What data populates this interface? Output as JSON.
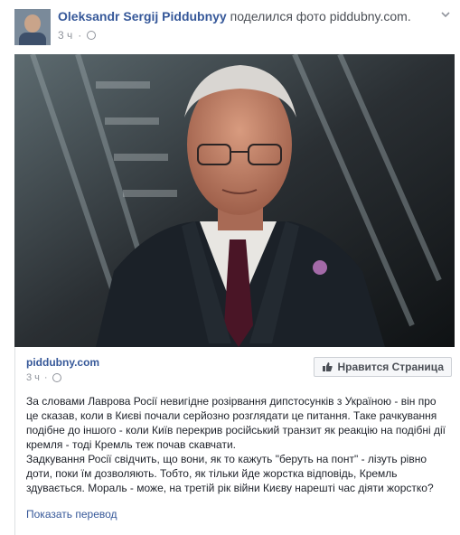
{
  "post": {
    "author": "Oleksandr Sergij Piddubnyy",
    "action": "поделился фото piddubny.com.",
    "time": "3 ч",
    "privacy_icon": "globe-icon",
    "menu_icon": "chevron-down-icon"
  },
  "card": {
    "site": "piddubny.com",
    "time": "3 ч",
    "privacy_icon": "globe-icon",
    "like_page_label": "Нравится Страница",
    "like_page_icon": "thumbs-up-icon",
    "paragraphs": [
      "За словами Лаврова Росії невигідне розірвання дипстосунків з Україною - він про це сказав, коли в Києві почали серйозно розглядати це питання. Таке рачкування подібне до іншого - коли Київ перекрив російський транзит як реакцію на подібні дії кремля - тоді Кремль теж почав скавчати.",
      "Задкування Росії свідчить, що вони, як то кажуть \"беруть на понт\" - лізуть рівно доти, поки їм дозволяють. Тобто, як тільки йде жорстка відповідь, Кремль здувається. Мораль - може, на третій рік війни Києву нарешті час діяти жорстко?"
    ],
    "translate_link": "Показать перевод"
  }
}
